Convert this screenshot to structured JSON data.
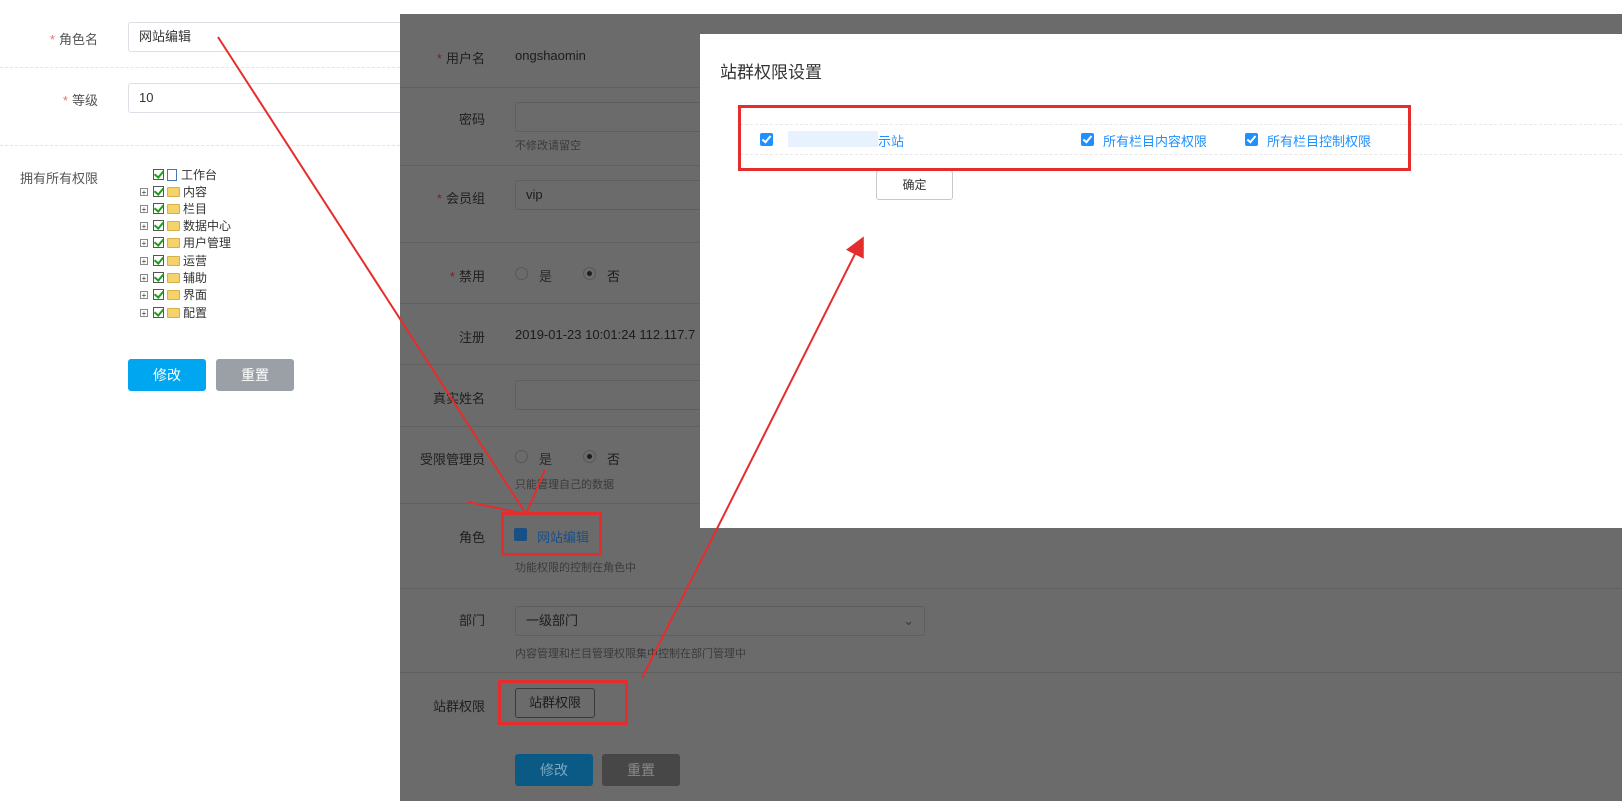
{
  "left_form": {
    "role_name": {
      "label": "角色名",
      "value": "网站编辑"
    },
    "level": {
      "label": "等级",
      "value": "10"
    },
    "permissions": {
      "label": "拥有所有权限",
      "tree": [
        "工作台",
        "内容",
        "栏目",
        "数据中心",
        "用户管理",
        "运营",
        "辅助",
        "界面",
        "配置"
      ]
    },
    "submit_label": "修改",
    "reset_label": "重置"
  },
  "background_form": {
    "username": {
      "label": "用户名",
      "value": "ongshaomin"
    },
    "password": {
      "label": "密码",
      "hint": "不修改请留空"
    },
    "member_group": {
      "label": "会员组",
      "value": "vip"
    },
    "disabled": {
      "label": "禁用",
      "yes": "是",
      "no": "否"
    },
    "register": {
      "label": "注册",
      "value": "2019-01-23 10:01:24 112.117.7"
    },
    "real_name": {
      "label": "真实姓名"
    },
    "limited_admin": {
      "label": "受限管理员",
      "yes": "是",
      "no": "否",
      "hint": "只能管理自己的数据"
    },
    "role": {
      "label": "角色",
      "option": "网站编辑",
      "hint": "功能权限的控制在角色中"
    },
    "department": {
      "label": "部门",
      "value": "一级部门",
      "hint": "内容管理和栏目管理权限集中控制在部门管理中"
    },
    "site_group": {
      "label": "站群权限",
      "button": "站群权限"
    },
    "submit_label": "修改",
    "reset_label": "重置"
  },
  "modal": {
    "title": "站群权限设置",
    "site_name": "示站",
    "content_perm": "所有栏目内容权限",
    "control_perm": "所有栏目控制权限",
    "confirm": "确定"
  },
  "colors": {
    "primary": "#00a6f0",
    "accent_blue": "#1e90ff",
    "annotation_red": "#e52d2d",
    "overlay": "#6b6b6b"
  }
}
